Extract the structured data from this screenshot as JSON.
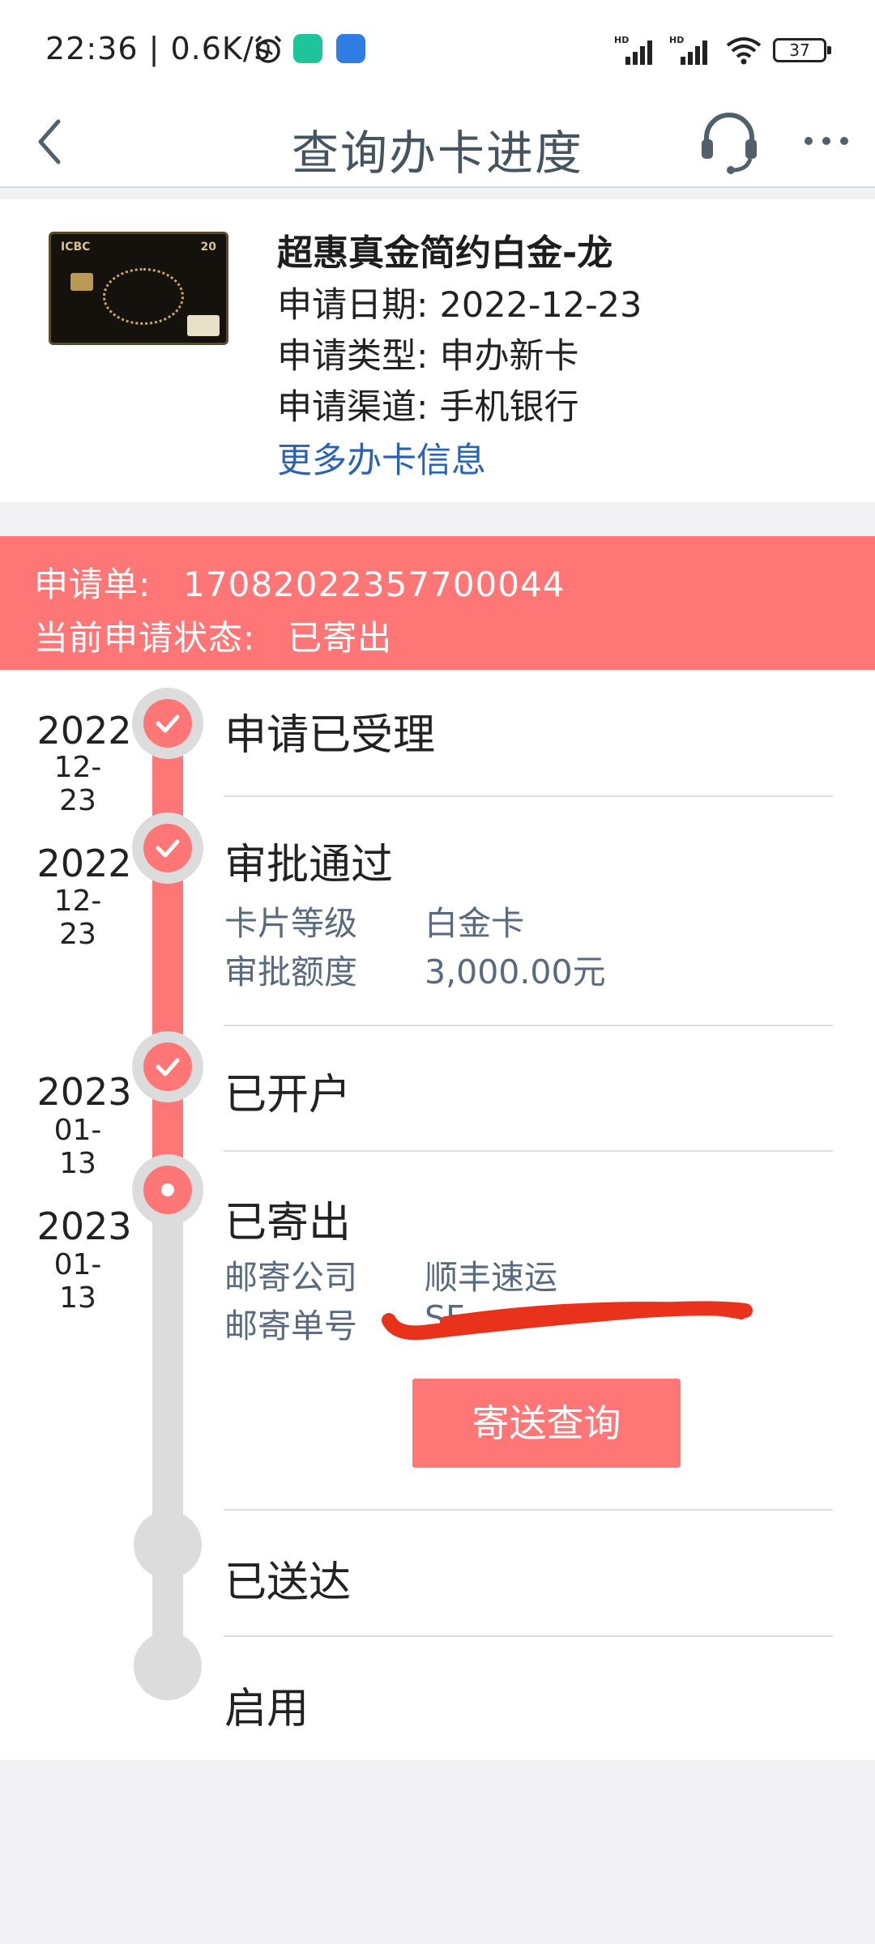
{
  "status_bar": {
    "time": "22:36 | 0.6K/s",
    "battery": "37",
    "signal_labels": [
      "HD",
      "HD"
    ]
  },
  "nav": {
    "title": "查询办卡进度",
    "icons": [
      "back-chevron-icon",
      "customer-service-headset-icon",
      "more-dots-icon"
    ]
  },
  "card": {
    "name": "超惠真金简约白金-龙",
    "image_text": [
      "ICBC",
      "20"
    ],
    "date_label": "申请日期:",
    "date_value": "2022-12-23",
    "type_label": "申请类型:",
    "type_value": "申办新卡",
    "channel_label": "申请渠道:",
    "channel_value": "手机银行",
    "more_link": "更多办卡信息"
  },
  "banner": {
    "order_label": "申请单:",
    "order_value": "17082022357700044",
    "status_label": "当前申请状态:",
    "status_value": "已寄出",
    "color": "#fe7776"
  },
  "timeline": {
    "steps": [
      {
        "year": "2022",
        "day": "12-23",
        "title": "申请已受理",
        "state": "done"
      },
      {
        "year": "2022",
        "day": "12-23",
        "title": "审批通过",
        "state": "done",
        "details": [
          {
            "label": "卡片等级",
            "value": "白金卡"
          },
          {
            "label": "审批额度",
            "value": "3,000.00元"
          }
        ]
      },
      {
        "year": "2023",
        "day": "01-13",
        "title": "已开户",
        "state": "done"
      },
      {
        "year": "2023",
        "day": "01-13",
        "title": "已寄出",
        "state": "current",
        "details": [
          {
            "label": "邮寄公司",
            "value": "顺丰速运"
          },
          {
            "label": "邮寄单号",
            "value": "SF"
          }
        ],
        "button": "寄送查询"
      },
      {
        "title": "已送达",
        "state": "pending"
      },
      {
        "title": "启用",
        "state": "pending"
      }
    ]
  },
  "colors": {
    "accent": "#fe7776",
    "link": "#2b63b3",
    "pending": "#dcdcdc"
  }
}
